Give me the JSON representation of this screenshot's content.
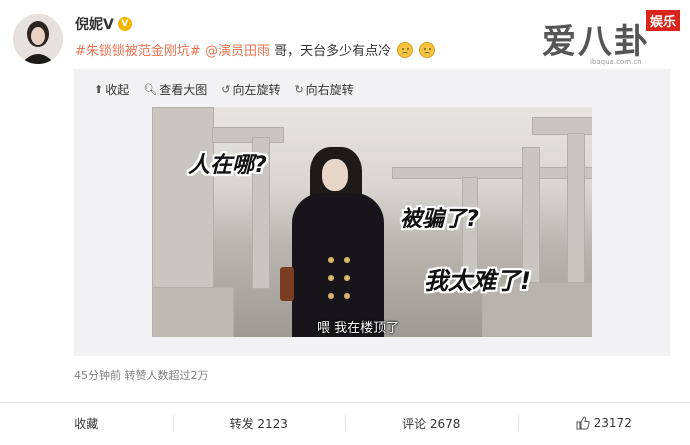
{
  "user": {
    "name": "倪妮V",
    "badge": "V"
  },
  "post": {
    "topic": "#朱锁锁被范金刚坑#",
    "mention": "@演员田雨",
    "text": " 哥，天台多少有点冷"
  },
  "watermark": {
    "title": "爱八卦",
    "tag": "娱乐",
    "url": "ibaqua.com.cn"
  },
  "toolbar": {
    "collapse": "收起",
    "view_large": "查看大图",
    "rotate_left": "向左旋转",
    "rotate_right": "向右旋转"
  },
  "image": {
    "captions": [
      "人在哪?",
      "被骗了?",
      "我太难了!"
    ],
    "subtitle": "喂  我在楼顶了"
  },
  "meta": "45分钟前 转赞人数超过2万",
  "actions": {
    "favorite": "收藏",
    "repost": "转发 2123",
    "comment": "评论 2678",
    "like": "23172"
  },
  "colors": {
    "link": "#eb7350",
    "badge": "#f7b500"
  }
}
